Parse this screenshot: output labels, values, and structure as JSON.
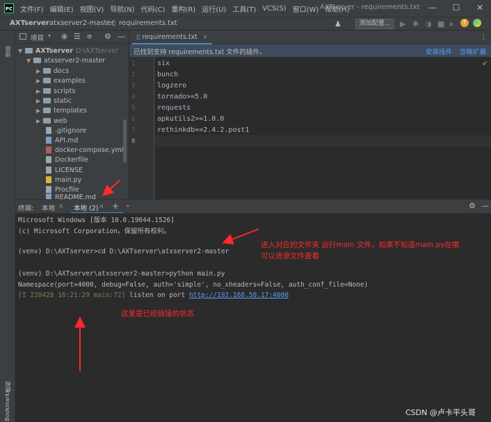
{
  "titlebar": {
    "logo": "PC",
    "menu": [
      "文件(F)",
      "编辑(E)",
      "视图(V)",
      "导航(N)",
      "代码(C)",
      "重构(R)",
      "运行(U)",
      "工具(T)",
      "VCS(S)",
      "窗口(W)",
      "帮助(H)"
    ],
    "title": "AXTserver - requirements.txt",
    "controls": [
      "—",
      "☐",
      "✕"
    ]
  },
  "navbar": {
    "crumb_project": "AXTserver",
    "crumb_folder": "atxserver2-master",
    "crumb_file": "requirements.txt",
    "add_config": "添加配置..."
  },
  "leftstrip": {
    "project_label": "项目",
    "structure_label": "结构",
    "bookmarks_label": "Bookmarks"
  },
  "project": {
    "toolbar_label": "项目",
    "root_name": "AXTserver",
    "root_path": "D:\\AXTserver",
    "folder": "atxserver2-master",
    "subfolders": [
      "docs",
      "examples",
      "scripts",
      "static",
      "templates",
      "web"
    ],
    "files": [
      ".gitignore",
      "API.md",
      "docker-compose.yml",
      "Dockerfile",
      "LICENSE",
      "main.py",
      "Procfile",
      "README.md"
    ]
  },
  "editor": {
    "tab": "requirements.txt",
    "banner": "已找到支持 requirements.txt 文件的插件。",
    "install_plugin": "安装插件",
    "ignore_extension": "忽略扩展",
    "line_numbers": [
      "1",
      "2",
      "3",
      "4",
      "5",
      "6",
      "7",
      "8"
    ],
    "lines": [
      "six",
      "bunch",
      "logzero",
      "tornado>=5.0",
      "requests",
      "apkutils2>=1.0.0",
      "rethinkdb==2.4.2.post1",
      ""
    ]
  },
  "terminal": {
    "label": "终端:",
    "tab_local": "本地",
    "tab_local2": "本地 (2)",
    "add": "+",
    "lines": [
      "Microsoft Windows [版本 10.0.19044.1526]",
      "(c) Microsoft Corporation。保留所有权利。",
      "",
      "(venv) D:\\AXTserver>cd D:\\AXTserver\\atxserver2-master",
      "",
      "(venv) D:\\AXTserver\\atxserver2-master>python main.py",
      "Namespace(port=4000, debug=False, auth='simple', no_xheaders=False, auth_conf_file=None)"
    ],
    "listen_prefix": "[I 220428 16:21:29 main:72]",
    "listen_text": " listen on port ",
    "listen_url": "http://192.168.50.17:4000"
  },
  "annotations": {
    "note1_line1": "进入对应的文件夹 运行main 文件，如果不知道main.py在哪",
    "note1_line2": "可以进源文件查看",
    "note2": "这里是已经链接的状态",
    "arrow_color": "#ff2a2a"
  },
  "watermark": "CSDN @卢卡平头哥"
}
